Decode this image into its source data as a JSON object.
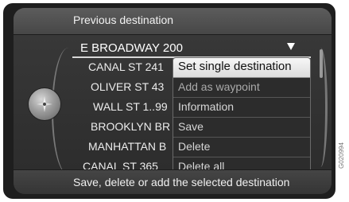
{
  "header": {
    "title": "Previous destination"
  },
  "selected": {
    "label": "E BROADWAY 200"
  },
  "destinations": [
    "CANAL ST 241",
    "OLIVER ST 43",
    "WALL ST 1..99",
    "BROOKLYN BR",
    "MANHATTAN B",
    "CANAL ST 365"
  ],
  "menu": {
    "items": [
      "Set single destination",
      "Add as waypoint",
      "Information",
      "Save",
      "Delete",
      "Delete all"
    ]
  },
  "footer": {
    "hint": "Save, delete or add the selected destination"
  },
  "reference_code": "G020994",
  "icons": {
    "knob": "navigation-compass-icon",
    "dropdown": "triangle-down-icon"
  }
}
